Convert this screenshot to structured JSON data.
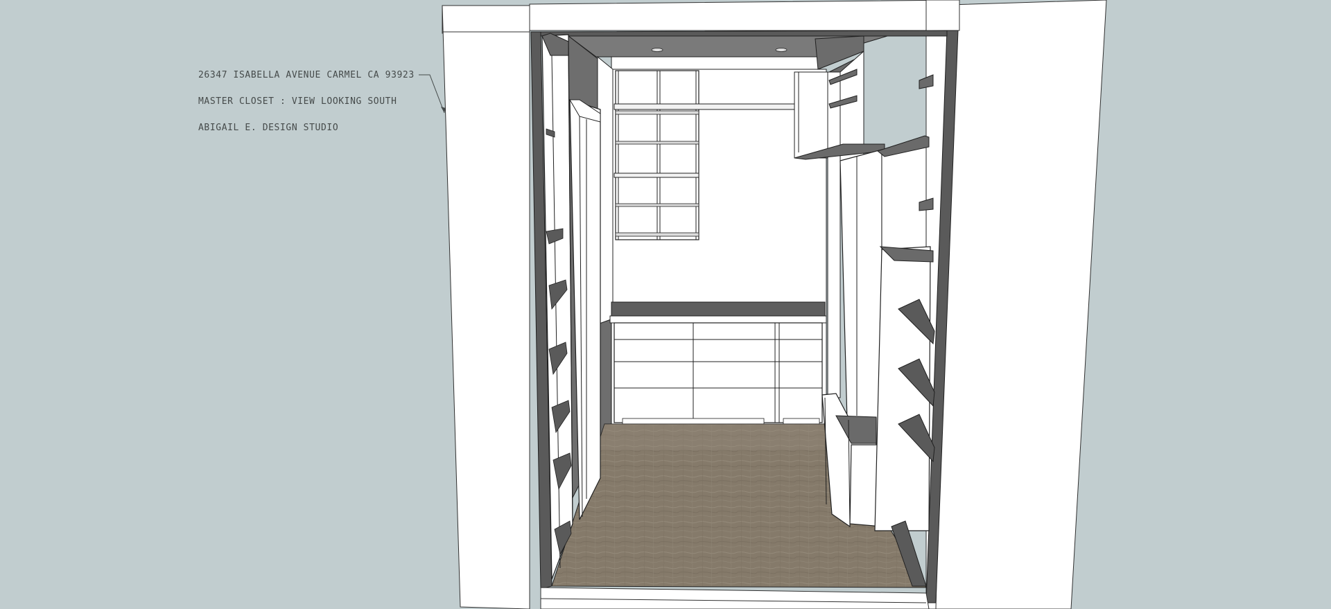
{
  "annotations": {
    "address": "26347 ISABELLA AVENUE CARMEL CA 93923",
    "view": "MASTER CLOSET : VIEW LOOKING SOUTH",
    "studio": "ABIGAIL E. DESIGN STUDIO"
  },
  "colors": {
    "background": "#c1cdcf",
    "wall": "#ffffff",
    "wall_shadow": "#6d6d6d",
    "dark_trim": "#585858",
    "floor": "#877c6c",
    "floor_light": "#948a7a",
    "edge": "#202020"
  }
}
